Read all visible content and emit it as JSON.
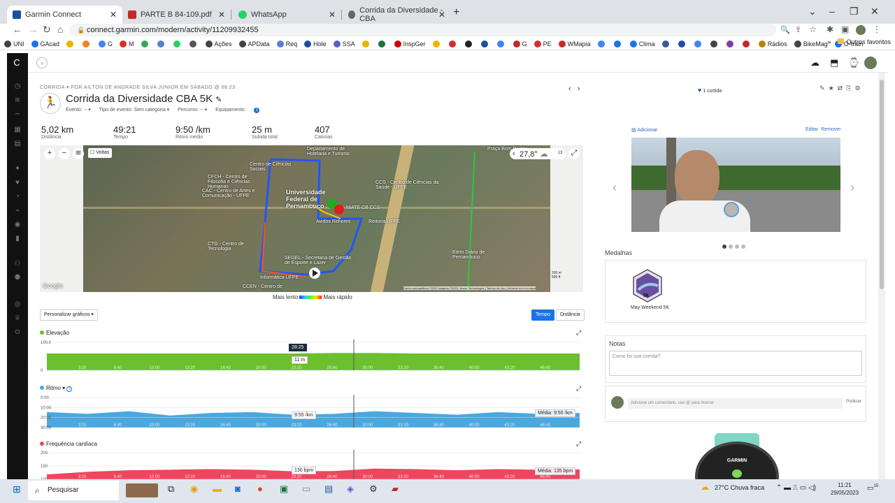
{
  "browser": {
    "tabs": [
      {
        "title": "Garmin Connect",
        "color": "#1a4fa0",
        "active": true
      },
      {
        "title": "PARTE B 84-109.pdf",
        "color": "#c62828",
        "active": false
      },
      {
        "title": "WhatsApp",
        "color": "#25d366",
        "active": false
      },
      {
        "title": "Corrida da Diversidade - CBA",
        "color": "#555555",
        "active": false
      }
    ],
    "url": "connect.garmin.com/modern/activity/11209932455",
    "bookmarks": [
      "UNI",
      "GAcad",
      "",
      "",
      "G",
      "M",
      "",
      "",
      "",
      "",
      "Ações",
      "APData",
      "Req",
      "Hole",
      "SSA",
      "",
      "",
      "InspGer",
      "",
      "",
      "",
      "",
      "",
      "G",
      "PE",
      "WMapia",
      "",
      "",
      "Clima",
      "",
      "",
      "",
      "",
      "",
      "",
      "Rádios",
      "BikeMag",
      "O-train"
    ],
    "bookmarks_more": "»",
    "other_bookmarks": "Outros favoritos"
  },
  "activity": {
    "breadcrumb": "CORRIDA ▾  POR AILTON DE ANDRADE SILVA JÚNIOR EM SÁBADO @ 08:23",
    "title": "Corrida da Diversidade CBA 5K",
    "meta": {
      "event": "Evento: -- ▾",
      "event_type": "Tipo de evento: Sem categoria ▾",
      "course": "Percurso: -- ▾",
      "gear": "Equipamento:"
    },
    "stats": [
      {
        "value": "5,02 km",
        "label": "Distância"
      },
      {
        "value": "49:21",
        "label": "Tempo"
      },
      {
        "value": "9:50 /km",
        "label": "Ritmo médio"
      },
      {
        "value": "25 m",
        "label": "Subida total"
      },
      {
        "value": "407",
        "label": "Calorias"
      }
    ]
  },
  "map": {
    "voltas": "Voltas",
    "temperature": "27,8°",
    "temp_badge": "13",
    "legend_slow": "Mais lento",
    "legend_fast": "Mais rápido",
    "attribution": "Dados cartográficos ©2023 Imagens ©2023, Maxar Technologies | Termos de Uso | Informar erro no mapa",
    "google": "Google",
    "scale_m": "200 m",
    "scale_ft": "500 ft",
    "labels": [
      "Universidade Federal de Pernambuco",
      "CCS - Centro de Ciências da Saúde - UFPE",
      "CAC - Centro de Artes e Comunicação - UFPE",
      "CFCH - Centro de Filosofia e Ciências Humanas",
      "CTG - Centro de Tecnologia",
      "SEGEL - Secretaria de Gestão de Esporte e Lazer",
      "Reitoria UFPE",
      "NIATE CB CCS",
      "Centro de Ciências Sociais",
      "Avidos Rehores",
      "Etem Diário de Pernambuco",
      "Departamento de Hotelaria e Turismo",
      "Praça Bom Pastor",
      "Informática UFPE",
      "CCEN - Centro de"
    ]
  },
  "charts_ui": {
    "customize": "Personalizar gráficos ▾",
    "toggle_time": "Tempo",
    "toggle_distance": "Distância",
    "elevation_label": "Elevação",
    "elevation_color": "#6cbf2d",
    "pace_label": "Ritmo ▾",
    "pace_color": "#4aa8e0",
    "hr_label": "Frequência cardíaca",
    "hr_color": "#f0455e",
    "elev_cursor_time": "28:25",
    "elev_cursor_value": "11 m",
    "pace_cursor_value": "9:55 /km",
    "pace_avg": "Média: 9:50 /km",
    "hr_cursor_value": "130 bpm",
    "hr_avg": "Média: 135 bpm"
  },
  "chart_data": [
    {
      "type": "area",
      "title": "Elevação",
      "x": [
        "3:20",
        "6:40",
        "10:00",
        "13:20",
        "16:40",
        "20:00",
        "23:20",
        "26:40",
        "30:00",
        "33:20",
        "36:40",
        "40:00",
        "43:20",
        "46:40"
      ],
      "series": [
        {
          "name": "Elevação",
          "values": [
            10,
            10,
            10,
            10,
            10,
            10,
            10,
            11,
            11,
            10,
            10,
            10,
            10,
            10
          ]
        }
      ],
      "ylim": [
        0,
        100
      ],
      "y_ticks": [
        "100,0",
        "0"
      ]
    },
    {
      "type": "area",
      "title": "Ritmo",
      "x": [
        "3:20",
        "6:40",
        "10:00",
        "13:20",
        "16:40",
        "20:00",
        "23:20",
        "26:40",
        "30:00",
        "33:20",
        "36:40",
        "40:00",
        "43:20",
        "46:40"
      ],
      "series": [
        {
          "name": "Ritmo",
          "values": [
            9.7,
            9.9,
            9.6,
            10.1,
            9.8,
            9.7,
            10.0,
            9.9,
            9.6,
            9.8,
            10.0,
            9.7,
            9.9,
            9.8
          ]
        }
      ],
      "y_ticks": [
        "0:00",
        "10:00",
        "20:00",
        "30:00"
      ],
      "average": "9:50 /km"
    },
    {
      "type": "area",
      "title": "Frequência cardíaca",
      "x": [
        "3:20",
        "6:40",
        "10:00",
        "13:20",
        "16:40",
        "20:00",
        "23:20",
        "26:40",
        "30:00",
        "33:20",
        "36:40",
        "40:00",
        "43:20",
        "46:40"
      ],
      "series": [
        {
          "name": "Frequência cardíaca",
          "values": [
            118,
            128,
            134,
            136,
            138,
            136,
            130,
            131,
            140,
            138,
            134,
            138,
            136,
            137
          ]
        }
      ],
      "ylim": [
        100,
        200
      ],
      "y_ticks": [
        "200",
        "150",
        "100"
      ],
      "average": "135 bpm"
    }
  ],
  "sidebar": {
    "likes": "1 curtida",
    "add": "Adicionar",
    "edit": "Editar",
    "remove": "Remover",
    "medals_title": "Medalhas",
    "medal_name": "May Weekend 5K",
    "medal_badge": "5k",
    "notes_title": "Notas",
    "notes_placeholder": "Como foi sua corrida?",
    "comment_placeholder": "Adicione um comentário, use @ para marcar",
    "publish": "Publicar",
    "watch_brand": "GARMIN"
  },
  "taskbar": {
    "search": "Pesquisar",
    "weather": "27°C  Chuva fraca",
    "time": "11:21",
    "date": "29/05/2023",
    "notif": "15"
  }
}
